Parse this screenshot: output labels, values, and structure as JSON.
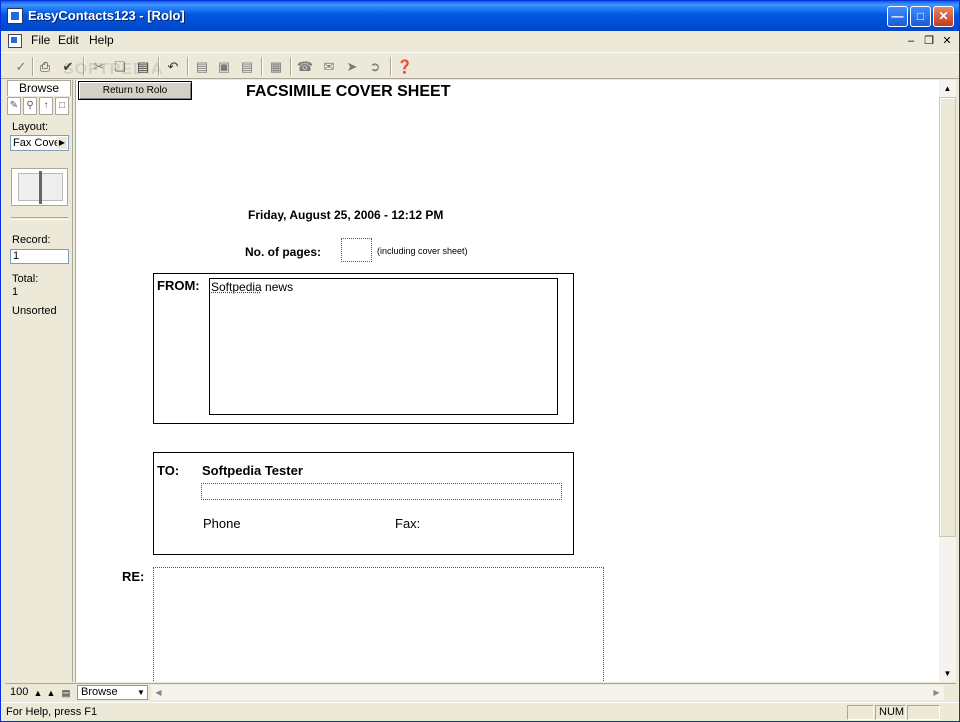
{
  "window": {
    "title": "EasyContacts123 - [Rolo]"
  },
  "menu": {
    "items": [
      "File",
      "Edit",
      "Help"
    ]
  },
  "watermark": "SOFTPEDIA",
  "left": {
    "mode_tab": "Browse",
    "layout_label": "Layout:",
    "layout_value": "Fax Cover",
    "record_label": "Record:",
    "record_value": "1",
    "total_label": "Total:",
    "total_value": "1",
    "sort_status": "Unsorted"
  },
  "document": {
    "return_button": "Return to Rolo",
    "title": "FACSIMILE COVER SHEET",
    "date_line": "Friday, August 25, 2006 - 12:12 PM",
    "pages_label": "No. of  pages:",
    "pages_note": "(including cover sheet)",
    "from_label": "FROM:",
    "from_value_word1": "Softpedia",
    "from_value_word2": " news",
    "to_label": "TO:",
    "to_name": "Softpedia Tester",
    "phone_label": "Phone",
    "fax_label": "Fax:",
    "re_label": "RE:"
  },
  "bottom": {
    "zoom": "100",
    "mode": "Browse"
  },
  "status": {
    "help_text": "For Help, press F1",
    "num": "NUM"
  }
}
